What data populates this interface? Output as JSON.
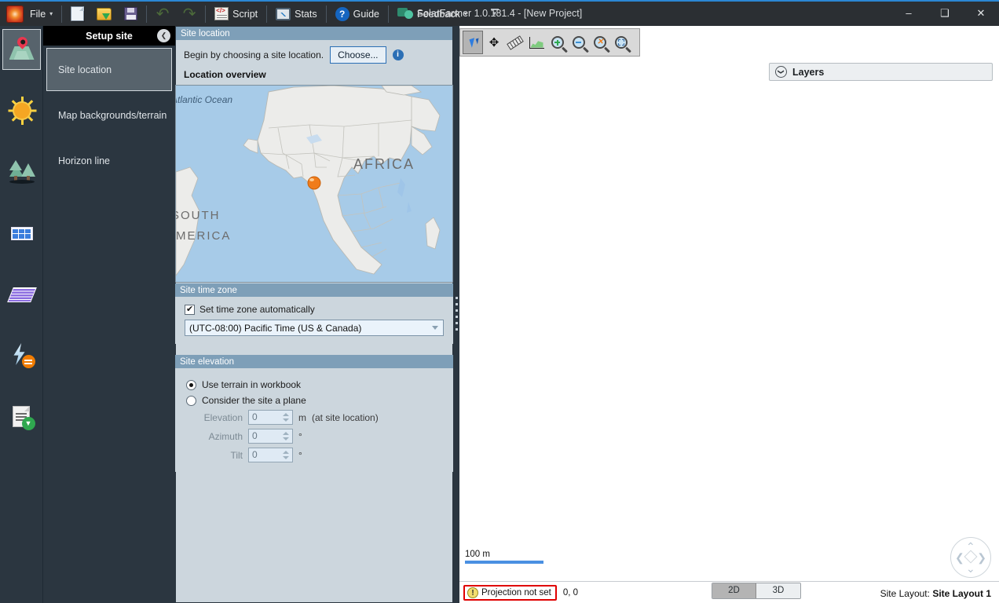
{
  "window": {
    "title": "SolarFarmer 1.0.181.4 - [New Project]",
    "minimize_label": "–",
    "maximize_label": "❑",
    "close_label": "✕"
  },
  "toolbar": {
    "logo_name": "solarfarmer-logo",
    "file_label": "File",
    "file_caret": "▾",
    "new_label": "new-document",
    "open_label": "open-project",
    "save_label": "save-project",
    "undo_label": "↶",
    "redo_label": "↷",
    "script_label": "Script",
    "stats_label": "Stats",
    "guide_label": "Guide",
    "guide_glyph": "?",
    "feedback_label": "Feedback",
    "feedback_caret": "▾",
    "overflow_label": "▾"
  },
  "rail": {
    "items": [
      {
        "name": "site-location",
        "icon": "map-pin-icon",
        "selected": true
      },
      {
        "name": "irradiance",
        "icon": "sun-icon",
        "selected": false
      },
      {
        "name": "shading-objects",
        "icon": "trees-icon",
        "selected": false
      },
      {
        "name": "modules",
        "icon": "panel-grid-icon",
        "selected": false
      },
      {
        "name": "array-layout",
        "icon": "panel-array-icon",
        "selected": false
      },
      {
        "name": "electrical",
        "icon": "lightning-bolt-icon",
        "selected": false
      },
      {
        "name": "reports",
        "icon": "document-download-icon",
        "selected": false
      }
    ]
  },
  "setup_nav": {
    "title": "Setup site",
    "collapse_glyph": "❮",
    "items": [
      {
        "label": "Site location",
        "selected": true
      },
      {
        "label": "Map backgrounds/terrain",
        "selected": false
      },
      {
        "label": "Horizon line",
        "selected": false
      }
    ]
  },
  "site_location": {
    "section_title": "Site location",
    "prompt": "Begin by choosing a site location.",
    "choose_button": "Choose...",
    "info_glyph": "i",
    "overview_label": "Location overview"
  },
  "map_thumb": {
    "ocean_label": "Atlantic Ocean",
    "africa_label": "AFRICA",
    "south_label": "SOUTH",
    "america_label": "AMERICA",
    "marker_name": "site-marker"
  },
  "time_zone": {
    "section_title": "Site time zone",
    "auto_checkbox_label": "Set time zone automatically",
    "auto_checked": true,
    "selected_zone": "(UTC-08:00) Pacific Time (US & Canada)"
  },
  "elevation": {
    "section_title": "Site elevation",
    "option_terrain": "Use terrain in workbook",
    "option_plane": "Consider the site a plane",
    "selected_option": "terrain",
    "fields": [
      {
        "label": "Elevation",
        "value": "0",
        "unit": "m",
        "note": "(at site location)"
      },
      {
        "label": "Azimuth",
        "value": "0",
        "unit": "°",
        "note": ""
      },
      {
        "label": "Tilt",
        "value": "0",
        "unit": "°",
        "note": ""
      }
    ]
  },
  "map_toolbar": {
    "tools": [
      {
        "name": "select-tool",
        "icon": "cursor-arrow-icon",
        "selected": true
      },
      {
        "name": "pan-tool",
        "icon": "pan-move-icon",
        "selected": false
      },
      {
        "name": "measure-tool",
        "icon": "ruler-icon",
        "selected": false
      },
      {
        "name": "profile-tool",
        "icon": "elevation-profile-icon",
        "selected": false
      },
      {
        "name": "zoom-in-tool",
        "icon": "magnifier-plus-icon",
        "selected": false
      },
      {
        "name": "zoom-out-tool",
        "icon": "magnifier-minus-icon",
        "selected": false
      },
      {
        "name": "zoom-reset-tool",
        "icon": "magnifier-reset-icon",
        "selected": false
      },
      {
        "name": "zoom-extents-tool",
        "icon": "magnifier-extents-icon",
        "selected": false
      }
    ]
  },
  "layers": {
    "title": "Layers",
    "chevron_glyph": "❯"
  },
  "scale": {
    "distance_label": "100 m"
  },
  "status": {
    "warning_glyph": "!",
    "warning_text": "Projection not set",
    "coordinates": "0, 0",
    "mode_2d": "2D",
    "mode_3d": "3D",
    "active_mode": "2D",
    "layout_label": "Site Layout:",
    "layout_value": "Site Layout 1"
  },
  "colors": {
    "accent_blue": "#2b87d4",
    "section_header": "#7e9fb8",
    "panel_bg": "#ccd6dd",
    "chrome_dark": "#2b3640",
    "warning_red": "#e00000",
    "marker_orange": "#f07c1a"
  }
}
